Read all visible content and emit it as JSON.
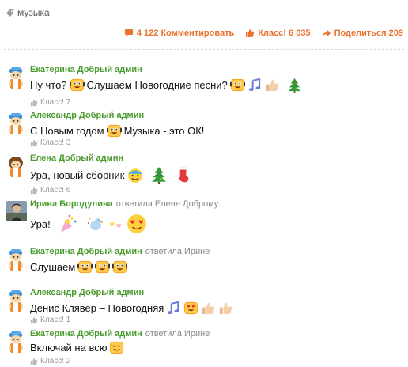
{
  "tag": {
    "label": "музыка",
    "icon": "tag-icon"
  },
  "actions": {
    "comments_label": "4 122 Комментировать",
    "like_label": "Класс! 6 035",
    "share_label": "Поделиться 209"
  },
  "comments": [
    {
      "author": "Екатерина Добрый админ",
      "reply_to": "",
      "text1": "Ну что?",
      "text2": "Слушаем Новогодние песни?",
      "like": "Класс! 7",
      "avatar": "admin-avatar"
    },
    {
      "author": "Александр Добрый админ",
      "reply_to": "",
      "text1": "С Новым годом",
      "text2": "Музыка - это ОК!",
      "like": "Класс! 3",
      "avatar": "admin-avatar"
    },
    {
      "author": "Елена Добрый админ",
      "reply_to": "",
      "text1": "Ура, новый сборник",
      "like": "Класс! 6",
      "avatar": "admin-avatar-girl"
    },
    {
      "author": "Ирина Бородулина",
      "reply_to": "ответила Елене Доброму",
      "text1": "Ура!",
      "avatar": "user-photo"
    },
    {
      "author": "Екатерина Добрый админ",
      "reply_to": "ответила Ирине",
      "text1": "Слушаем",
      "avatar": "admin-avatar"
    },
    {
      "author": "Александр Добрый админ",
      "reply_to": "",
      "text1": "Денис Клявер – Новогодняя",
      "like": "Класс! 1",
      "avatar": "admin-avatar"
    },
    {
      "author": "Екатерина Добрый админ",
      "reply_to": "ответила Ирине",
      "text1": "Включай на всю",
      "like": "Класс! 2",
      "avatar": "admin-avatar"
    }
  ],
  "colors": {
    "accent": "#eb722e",
    "author": "#4a9b2f",
    "muted": "#9a9a9a"
  }
}
